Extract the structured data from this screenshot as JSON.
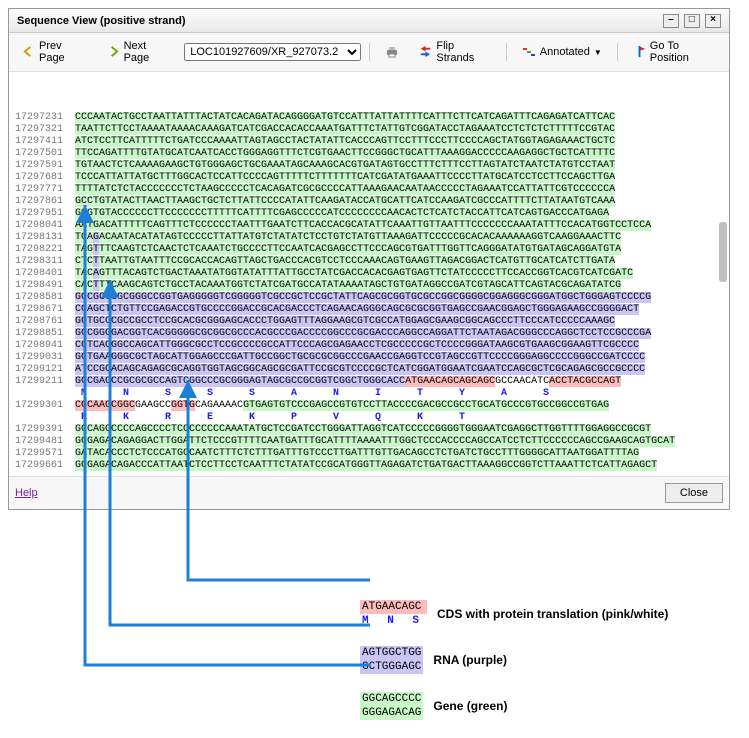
{
  "window": {
    "title": "Sequence View (positive strand)"
  },
  "toolbar": {
    "prev": "Prev Page",
    "next": "Next Page",
    "locator_value": "LOC101927609/XR_927073.2",
    "flip": "Flip Strands",
    "annotated": "Annotated",
    "goto": "Go To Position"
  },
  "rows": [
    {
      "pos": "17297231",
      "runs": [
        {
          "cls": "g",
          "t": "CCCAATACTGCCTAATTATTTACTATCACAGATACAGGGGATGTCCATTTATTATTTTCATTTCTTCATCAGATTTCAGAGATCATTCAC"
        }
      ]
    },
    {
      "pos": "17297321",
      "runs": [
        {
          "cls": "g",
          "t": "TAATTCTTCCTAAAATAAAACAAAGATCATCGACCACACCAAATGATTTCTATTGTCGGATACCTAGAAATCCTCTCTCTTTTTCCGTAC"
        }
      ]
    },
    {
      "pos": "17297411",
      "runs": [
        {
          "cls": "g",
          "t": "ATCTCCTTCATTTTTCTGATCCCAAAATTAGTAGCCTACTATATTCACCCAGTTCCTTTCCCTTCCCCAGCTATGGTAGAGAAACTGCTC"
        }
      ]
    },
    {
      "pos": "17297501",
      "runs": [
        {
          "cls": "g",
          "t": "TTCCAGATTTTGTATGCATCAATCACCTGGGAGGTTTCTCGTGAACTTCCGGGCTGCATTTAAAGGACCCCCAAGAGGCTGCTCATTTTC"
        }
      ]
    },
    {
      "pos": "17297591",
      "runs": [
        {
          "cls": "g",
          "t": "TGTAACTCTCAAAAGAAGCTGTGGGAGCTGCGAAATAGCAAAGCACGTGATAGTGCCTTTCTTTCCTTAGTATCTAATCTATGTCCTAAT"
        }
      ]
    },
    {
      "pos": "17297681",
      "runs": [
        {
          "cls": "g",
          "t": "TCCCATTATTATGCTTTGGCACTCCATTCCCCAGTTTTTCTTTTTTTCATCGATATGAAATTCCCCTTATGCATCCTCCTTCCAGCTTGA"
        }
      ]
    },
    {
      "pos": "17297771",
      "runs": [
        {
          "cls": "g",
          "t": "TTTTATCTCTACCCCCCCTCTAAGCCCCCTCACAGATCGCGCCCCATTAAAGAACAATAACCCCCTAGAAATCCATTATTCGTCCCCCCA"
        }
      ]
    },
    {
      "pos": "17297861",
      "runs": [
        {
          "cls": "g",
          "t": "GCCTGTATACTTAACTTAAGCTGCTCTTATTCCCCATATTCAAGATACCATGCATTCATCCAAGATCGCCCATTTTCTTATAATGTCAAA"
        }
      ]
    },
    {
      "pos": "17297951",
      "runs": [
        {
          "cls": "g",
          "t": "GGGTGTACCCCCCTTCCCCCCCTTTTTCATTTTCGAGCCCCCATCCCCCCCCAACACTCTCATCTACCATTCATCAGTGACCCATGAGA"
        }
      ]
    },
    {
      "pos": "17298041",
      "runs": [
        {
          "cls": "g",
          "t": "AATGACATTTTTCAGTTTCTCCCCCCTAATTTGAATCTTCACCACGCATATTCAAATTGTTAATTTCCCCCCCAAATATTTCCACATGGTCCTCCA"
        }
      ]
    },
    {
      "pos": "17298131",
      "runs": [
        {
          "cls": "g",
          "t": "TGA"
        },
        {
          "cls": "r",
          "t": "G"
        },
        {
          "cls": "g",
          "t": "ACAATACATATAGTCCCCCTTATTATGTCTATATCTCCTGTCTATGTTAAAGATTCCCCCGCACACAAAAAAGGTCAAGGAAACTTC"
        }
      ]
    },
    {
      "pos": "17298221",
      "runs": [
        {
          "cls": "g",
          "t": "TAG"
        },
        {
          "cls": "r",
          "t": "T"
        },
        {
          "cls": "g",
          "t": "TTCAAGTCTCAACTCTCAAATCTGCCCCTTCCAATCACGAGCCTTCCCAGCGTGATTTGGTTCAGGGATATGTGATAGCAGGATGTA"
        }
      ]
    },
    {
      "pos": "17298311",
      "runs": [
        {
          "cls": "g",
          "t": "CTC"
        },
        {
          "cls": "r",
          "t": "T"
        },
        {
          "cls": "g",
          "t": "TAATTGTAATTTCCGCACCACAGTTAGCTGACCCACGTCCTCCCAAACAGTGAAGTTAGACGGACTCATGTTGCATCATCTTGATA"
        }
      ]
    },
    {
      "pos": "17298401",
      "runs": [
        {
          "cls": "g",
          "t": "TAC"
        },
        {
          "cls": "r",
          "t": "A"
        },
        {
          "cls": "g",
          "t": "GTTTACAGTCTGACTAAATATGGTATATTTATTGCCTATCGACCACACGAGTGAGTTCTATCCCCCTTCCACCGGTCACGTCATCGATC"
        }
      ]
    },
    {
      "pos": "17298491",
      "runs": [
        {
          "cls": "g",
          "t": "CAC"
        },
        {
          "cls": "r",
          "t": "T"
        },
        {
          "cls": "g",
          "t": "TTCAAGCAGTCTGCCTACAAATGGTCTATCGATGCCATATAAAATAGCTGTGATAGGCCGATCGTAGCATTCAGTACGCAGATATCG"
        }
      ]
    },
    {
      "pos": "17298581",
      "runs": [
        {
          "cls": "r",
          "t": "GGCGGGGGCGGGCCGGTGAGGGGGTCGGGGGTCGCCGCTCCGCTATTCAGCGCGGTGCGCCGGCGGGGCGGAGGGCGGGATGGCTGGGAGTCCCCG"
        }
      ]
    },
    {
      "pos": "17298671",
      "runs": [
        {
          "cls": "r",
          "t": "CGAGCTCTGTTCCGAGACCGTGCCCCGGACCGCACGACCCTCAGAACAGGGCAGCGCGCGGTGAGCCGAACGGAGCTGGGAGAAGCCGGGGACT"
        }
      ]
    },
    {
      "pos": "17298761",
      "runs": [
        {
          "cls": "r",
          "t": "GCTGCCCGCCGCCTCCGCACGCGGGAGCACCCTGGAGTTTAGGAAGCGTCGCCATGGAGCGAAGCGGCAGCCCTTCCCATCCCCCAAAGC"
        }
      ]
    },
    {
      "pos": "17298851",
      "runs": [
        {
          "cls": "r",
          "t": "GCCGGGGACGGTCACGGGGGCGCGGCGCCCACGCCCGACCCCGGCCCGCGACCCAGGCCAGGATTCTAATAGACGGGCCCAGGCTCCTCCGCCCGA"
        }
      ]
    },
    {
      "pos": "17298941",
      "runs": [
        {
          "cls": "r",
          "t": "CCTCACGGCCAGCATTGGGCGCCTCCGCCCCGCCATTCCCAGCGAGAACCTCGCCCCCGCTCCCCGGGATAAGCGTGAAGCGGAAGTTCGCCCC"
        }
      ]
    },
    {
      "pos": "17299031",
      "runs": [
        {
          "cls": "r",
          "t": "GGTGAAGGGCGCTAGCATTGGAGCCCGATTGCCGGCTGCGCGCGGCCCGAACCGAGGTCCGTAGCCGTTCCCCGGGAGGCCCCGGGCCGATCCCC"
        }
      ]
    },
    {
      "pos": "17299121",
      "runs": [
        {
          "cls": "r",
          "t": "ATCCGCACAGCAGAGCGCAGGTGGTAGCGGCAGCGCGATTCCGCGTCCCCGCTCATCGGATGGAATCGAATCCAGCGCTCGCAGAGCGCCGCCCC"
        }
      ]
    },
    {
      "pos": "17299211",
      "runs": [
        {
          "cls": "r",
          "t": "GGCGACCCGCGCGCCAGTCGGCCCGCGGGAGTAGCGCCGCGGTCGGCTGGGCACC"
        },
        {
          "cls": "c",
          "t": "ATGAACAGCAGCAGC"
        },
        {
          "cls": "w",
          "t": "GCCAACATC"
        },
        {
          "cls": "c",
          "t": "ACCTACGCCAGT"
        }
      ]
    },
    {
      "pos": "",
      "runs": [
        {
          "cls": "",
          "t": "                                                         "
        }
      ],
      "protein": "M  N  S  S  S  A  N  I  T  Y  A  S"
    },
    {
      "pos": "17299301",
      "runs": [
        {
          "cls": "c",
          "t": "CGCAAGCGGC"
        },
        {
          "cls": "w",
          "t": "GAAGCC"
        },
        {
          "cls": "c",
          "t": "GGTG"
        },
        {
          "cls": "w",
          "t": "CAGAAAAC"
        },
        {
          "cls": "g",
          "t": "GTGAGTGTCCCGAGCCGTGTCCTTACCCCGACGCCGCCTGCATGCCCGTGCCGGCCGTGAG"
        }
      ]
    },
    {
      "pos": "",
      "runs": [
        {
          "cls": "",
          "t": " "
        }
      ],
      "protein": "R  K  R  E  K  P  V  Q  K  T"
    },
    {
      "pos": "17299391",
      "runs": [
        {
          "cls": "g",
          "t": "GGCAGCCCCCAGCCCCTCCCCCCCCAAATATGCTCCGATCCTGGGATTAGGTCATCCCCCGGGGTGGGAATCGAGGCTTGGTTTTGGAGGCCGCGT"
        }
      ]
    },
    {
      "pos": "17299481",
      "runs": [
        {
          "cls": "g",
          "t": "GGGAGACAGAGGACTTGGATTCTCCCGTTTTCAATGATTTGCATTTTAAAATTTGGCTCCCACCCCAGCCATCCTCTTCCCCCCAGCCGAAGCAGTGCAT"
        }
      ]
    },
    {
      "pos": "17299571",
      "runs": [
        {
          "cls": "g",
          "t": "GATACACCCTCTCCCATGCCAATCTTTCTCTTTGATTTGTCCCTTGATTTGTTGACAGCCTCTGATCTGCCTTTGGGGCATTAATGGATTTTAG"
        }
      ]
    },
    {
      "pos": "17299661",
      "runs": [
        {
          "cls": "g",
          "t": "GGGAGACAGACCCATTAATCTCCTTCCTCAATTTCTATATCCGCATGGGTTAGAGATCTGATGACTTAAAGGCCGGTCTTAAATTCTCATTAGAGCT"
        }
      ]
    }
  ],
  "footer": {
    "help": "Help",
    "close": "Close"
  },
  "legend": {
    "cds": {
      "sample1": "ATGAACAGC",
      "sample2": "M  N  S",
      "label": "CDS with protein translation (pink/white)"
    },
    "rna": {
      "sample1": "AGTGGCTGG",
      "sample2": "GCTGGGAGC",
      "label": "RNA (purple)"
    },
    "gene": {
      "sample1": "GGCAGCCCC",
      "sample2": "GGGAGACAG",
      "label": "Gene (green)"
    }
  }
}
